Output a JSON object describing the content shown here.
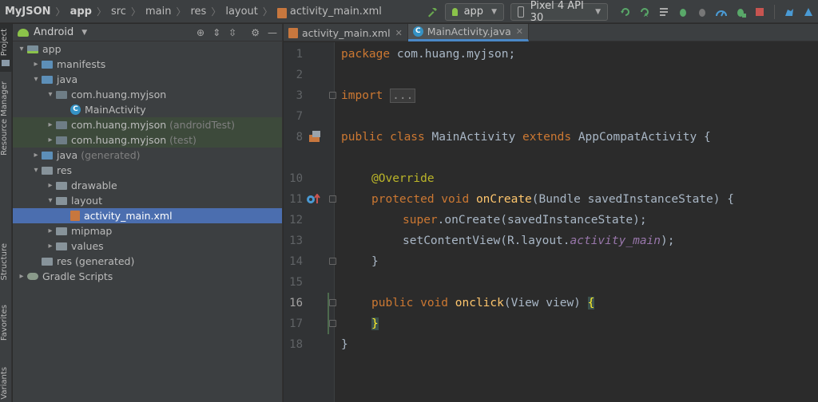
{
  "breadcrumb": {
    "items": [
      {
        "label": "MyJSON",
        "bold": true
      },
      {
        "label": "app",
        "bold": true
      },
      {
        "label": "src"
      },
      {
        "label": "main"
      },
      {
        "label": "res"
      },
      {
        "label": "layout"
      },
      {
        "label": "activity_main.xml"
      }
    ]
  },
  "toolbar": {
    "run_config": "app",
    "device": "Pixel 4 API 30"
  },
  "strip": {
    "project": "Project",
    "resource_manager": "Resource Manager",
    "structure": "Structure",
    "favorites": "Favorites",
    "variants": "Variants"
  },
  "project_panel": {
    "view_mode": "Android",
    "tree": [
      {
        "label": "app",
        "indent": 0,
        "arrow": "▾",
        "icon": "app"
      },
      {
        "label": "manifests",
        "indent": 1,
        "arrow": "▸",
        "icon": "folder-blue"
      },
      {
        "label": "java",
        "indent": 1,
        "arrow": "▾",
        "icon": "folder-blue"
      },
      {
        "label": "com.huang.myjson",
        "indent": 2,
        "arrow": "▾",
        "icon": "folder-gray"
      },
      {
        "label": "MainActivity",
        "indent": 3,
        "arrow": "",
        "icon": "class"
      },
      {
        "label": "com.huang.myjson",
        "suffix": "(androidTest)",
        "indent": 2,
        "arrow": "▸",
        "icon": "folder-gray",
        "state": "hl-green"
      },
      {
        "label": "com.huang.myjson",
        "suffix": "(test)",
        "indent": 2,
        "arrow": "▸",
        "icon": "folder-gray",
        "state": "hl-green"
      },
      {
        "label": "java",
        "suffix": "(generated)",
        "indent": 1,
        "arrow": "▸",
        "icon": "folder-blue"
      },
      {
        "label": "res",
        "indent": 1,
        "arrow": "▾",
        "icon": "folder"
      },
      {
        "label": "drawable",
        "indent": 2,
        "arrow": "▸",
        "icon": "folder"
      },
      {
        "label": "layout",
        "indent": 2,
        "arrow": "▾",
        "icon": "folder"
      },
      {
        "label": "activity_main.xml",
        "indent": 3,
        "arrow": "",
        "icon": "xml",
        "state": "selected"
      },
      {
        "label": "mipmap",
        "indent": 2,
        "arrow": "▸",
        "icon": "folder"
      },
      {
        "label": "values",
        "indent": 2,
        "arrow": "▸",
        "icon": "folder"
      },
      {
        "label": "res (generated)",
        "indent": 1,
        "arrow": "",
        "icon": "folder"
      },
      {
        "label": "Gradle Scripts",
        "indent": 0,
        "arrow": "▸",
        "icon": "gradle"
      }
    ]
  },
  "tabs": [
    {
      "label": "activity_main.xml",
      "icon": "xml"
    },
    {
      "label": "MainActivity.java",
      "icon": "class",
      "active": true
    }
  ],
  "editor": {
    "line_numbers": [
      "1",
      "2",
      "3",
      "7",
      "8",
      "10",
      "11",
      "12",
      "13",
      "14",
      "15",
      "16",
      "17",
      "18"
    ],
    "lines": {
      "l1": {
        "kw": "package",
        "rest": " com.huang.myjson;"
      },
      "l3": {
        "kw": "import",
        "fold": "..."
      },
      "l8": {
        "kw": "public class",
        "name": " MainActivity ",
        "kw2": "extends",
        "rest": " AppCompatActivity {"
      },
      "l10": {
        "ann": "@Override"
      },
      "l11": {
        "kw": "protected void",
        "fn": "onCreate",
        "rest": "(Bundle savedInstanceState) {"
      },
      "l12": {
        "kw": "super",
        "dot": ".",
        "call": "onCreate",
        "rest": "(savedInstanceState);"
      },
      "l13": {
        "pre": "setContentView(R.layout.",
        "field": "activity_main",
        "rest": ");"
      },
      "l14": {
        "text": "}"
      },
      "l16": {
        "kw": "public void",
        "fn": "onclick",
        "rest": "(View view) ",
        "brace": "{"
      },
      "l17": {
        "brace": "}"
      },
      "l18": {
        "text": "}"
      }
    }
  },
  "colors": {
    "keyword": "#cc7832",
    "annotation": "#bbb529",
    "method": "#ffc66d",
    "field": "#9876aa",
    "selection": "#4b6eaf",
    "test_highlight": "#3d4a3b"
  }
}
